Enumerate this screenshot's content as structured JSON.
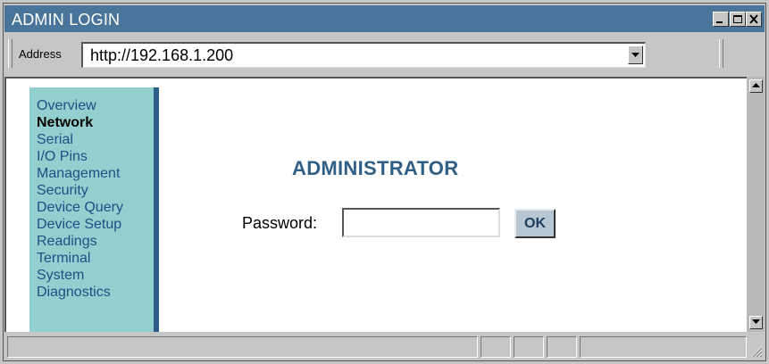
{
  "window": {
    "title": "ADMIN LOGIN",
    "controls": [
      "minimize-icon",
      "maximize-icon",
      "close-icon"
    ]
  },
  "address_bar": {
    "label": "Address",
    "url": "http://192.168.1.200"
  },
  "sidebar": {
    "items": [
      {
        "label": "Overview",
        "active": false
      },
      {
        "label": "Network",
        "active": true
      },
      {
        "label": "Serial",
        "active": false
      },
      {
        "label": "I/O Pins",
        "active": false
      },
      {
        "label": "Management",
        "active": false
      },
      {
        "label": "Security",
        "active": false
      },
      {
        "label": "Device Query",
        "active": false
      },
      {
        "label": "Device Setup",
        "active": false
      },
      {
        "label": "Readings",
        "active": false
      },
      {
        "label": "Terminal",
        "active": false
      },
      {
        "label": "System",
        "active": false
      },
      {
        "label": "Diagnostics",
        "active": false
      }
    ]
  },
  "main": {
    "title": "ADMINISTRATOR",
    "password_label": "Password:",
    "password_value": "",
    "ok_label": "OK"
  },
  "colors": {
    "titlebar": "#4a759b",
    "sidebar_bg": "#94cfcf",
    "sidebar_border": "#2d5c86",
    "link": "#1f4e86",
    "heading": "#2f5f86"
  }
}
